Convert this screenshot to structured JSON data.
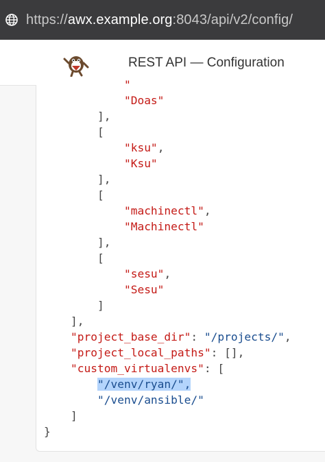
{
  "browser": {
    "url_scheme": "https://",
    "url_host": "awx.example.org",
    "url_rest": ":8043/api/v2/config/"
  },
  "header": {
    "title": "REST API — Configuration"
  },
  "code": {
    "lines": [
      [
        {
          "t": "            "
        },
        {
          "t": "\"",
          "c": "str"
        }
      ],
      [
        {
          "t": "            "
        },
        {
          "t": "\"Doas\"",
          "c": "str"
        }
      ],
      [
        {
          "t": "        ],"
        }
      ],
      [
        {
          "t": "        ["
        }
      ],
      [
        {
          "t": "            "
        },
        {
          "t": "\"ksu\"",
          "c": "str"
        },
        {
          "t": ","
        }
      ],
      [
        {
          "t": "            "
        },
        {
          "t": "\"Ksu\"",
          "c": "str"
        }
      ],
      [
        {
          "t": "        ],"
        }
      ],
      [
        {
          "t": "        ["
        }
      ],
      [
        {
          "t": "            "
        },
        {
          "t": "\"machinectl\"",
          "c": "str"
        },
        {
          "t": ","
        }
      ],
      [
        {
          "t": "            "
        },
        {
          "t": "\"Machinectl\"",
          "c": "str"
        }
      ],
      [
        {
          "t": "        ],"
        }
      ],
      [
        {
          "t": "        ["
        }
      ],
      [
        {
          "t": "            "
        },
        {
          "t": "\"sesu\"",
          "c": "str"
        },
        {
          "t": ","
        }
      ],
      [
        {
          "t": "            "
        },
        {
          "t": "\"Sesu\"",
          "c": "str"
        }
      ],
      [
        {
          "t": "        ]"
        }
      ],
      [
        {
          "t": "    ],"
        }
      ],
      [
        {
          "t": "    "
        },
        {
          "t": "\"project_base_dir\"",
          "c": "str"
        },
        {
          "t": ": "
        },
        {
          "t": "\"/projects/\"",
          "c": "val"
        },
        {
          "t": ","
        }
      ],
      [
        {
          "t": "    "
        },
        {
          "t": "\"project_local_paths\"",
          "c": "str"
        },
        {
          "t": ": [],"
        }
      ],
      [
        {
          "t": "    "
        },
        {
          "t": "\"custom_virtualenvs\"",
          "c": "str"
        },
        {
          "t": ": ["
        }
      ],
      [
        {
          "t": "        "
        },
        {
          "t": "\"/venv/ryan/\",",
          "c": "val sel"
        }
      ],
      [
        {
          "t": "        "
        },
        {
          "t": "\"/venv/ansible/\"",
          "c": "val"
        }
      ],
      [
        {
          "t": "    ]"
        }
      ],
      [
        {
          "t": "}"
        }
      ]
    ]
  },
  "icons": {
    "address_bar": "globe-icon",
    "logo": "awx-mascot-logo"
  },
  "colors": {
    "url_bar_bg": "#3b3b3d",
    "json_key": "#c41a16",
    "json_value": "#1a4d8f",
    "selection": "#b3d4fc"
  }
}
